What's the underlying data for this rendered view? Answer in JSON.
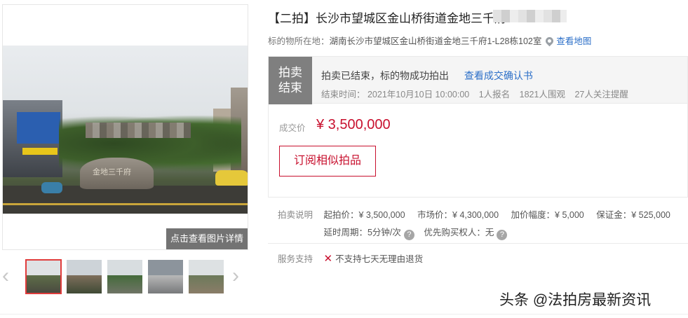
{
  "gallery": {
    "main_caption": "点击查看图片详情",
    "stone_text": "金地三千府",
    "prev_icon": "chevron-left-icon",
    "next_icon": "chevron-right-icon",
    "thumbnails": [
      {
        "active": true
      },
      {
        "active": false
      },
      {
        "active": false
      },
      {
        "active": false
      },
      {
        "active": false
      }
    ]
  },
  "header": {
    "title": "【二拍】长沙市望城区金山桥街道金地三千府",
    "location_label": "标的物所在地：",
    "location_value": "湖南长沙市望城区金山桥街道金地三千府1-L28栋102室",
    "map_link": "查看地图"
  },
  "status": {
    "badge_line1": "拍卖",
    "badge_line2": "结束",
    "message": "拍卖已结束，标的物成功拍出",
    "confirm_link": "查看成交确认书",
    "end_time": "结束时间： 2021年10月10日 10:00:00",
    "signups": "1人报名",
    "views": "1821人围观",
    "followers": "27人关注提醒"
  },
  "price": {
    "label": "成交价",
    "value": "¥ 3,500,000",
    "subscribe_button": "订阅相似拍品"
  },
  "auction_info": {
    "label": "拍卖说明",
    "start_price": "起拍价：¥ 3,500,000",
    "market_price": "市场价：¥ 4,300,000",
    "increment": "加价幅度：¥ 5,000",
    "deposit": "保证金：¥ 525,000",
    "delay_period": "延时周期：5分钟/次",
    "priority_buyer": "优先购买权人：无",
    "help_glyph": "?"
  },
  "service": {
    "label": "服务支持",
    "no_return": "不支持七天无理由退货"
  },
  "watermark": "头条 @法拍房最新资讯",
  "colors": {
    "accent_red": "#c8102e",
    "link_blue": "#2c6fc8",
    "badge_gray": "#7f7f7f"
  }
}
